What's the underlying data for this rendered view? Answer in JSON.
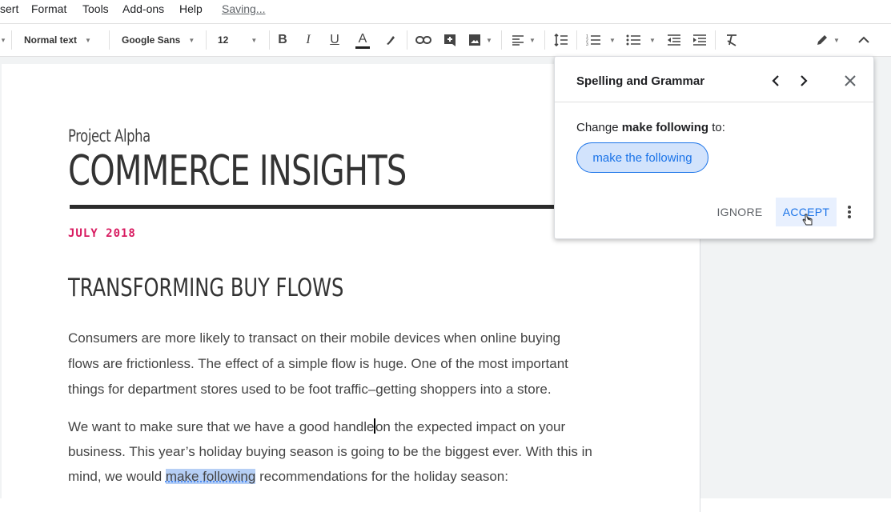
{
  "menu": {
    "items": [
      "sert",
      "Format",
      "Tools",
      "Add-ons",
      "Help"
    ],
    "status": "Saving..."
  },
  "toolbar": {
    "style_select": "Normal text",
    "font_select": "Google Sans",
    "size_select": "12",
    "icons": [
      "bold-icon",
      "italic-icon",
      "underline-icon",
      "text-color-icon",
      "highlight-icon",
      "link-icon",
      "comment-icon",
      "image-icon",
      "align-icon",
      "line-spacing-icon",
      "numbered-list-icon",
      "bulleted-list-icon",
      "decrease-indent-icon",
      "increase-indent-icon",
      "clear-formatting-icon",
      "editing-mode-icon",
      "collapse-icon"
    ],
    "bold_label": "B",
    "italic_label": "I",
    "underline_label": "U",
    "textcolor_label": "A"
  },
  "document": {
    "subtitle": "Project Alpha",
    "title": "COMMERCE INSIGHTS",
    "date": "JULY 2018",
    "heading": "TRANSFORMING BUY FLOWS",
    "para1": [
      "Consumers are more likely to transact on their mobile devices when online buying",
      "flows are frictionless. The effect of a simple flow is huge. One of the most important",
      "things for department stores used to be foot traffic–getting shoppers into a store."
    ],
    "para2_line1_a": "We want to make sure that we have a good handle",
    "para2_line1_b": "on the expected impact on your",
    "para2_line2": "business. This year’s holiday buying season is going to be the biggest ever. With this in",
    "para2_line3_a": "mind, we would ",
    "para2_line3_hl": "make following",
    "para2_line3_b": " recommendations for the holiday season:"
  },
  "spelling_panel": {
    "title": "Spelling and Grammar",
    "change_prefix": "Change ",
    "change_word": "make following",
    "change_suffix": " to:",
    "suggestion": "make the following",
    "ignore_label": "IGNORE",
    "accept_label": "ACCEPT",
    "colors": {
      "accent": "#1a73e8",
      "suggestion_bg": "#d2e3fc",
      "highlight": "#b6cff5",
      "date": "#d81b60"
    }
  }
}
